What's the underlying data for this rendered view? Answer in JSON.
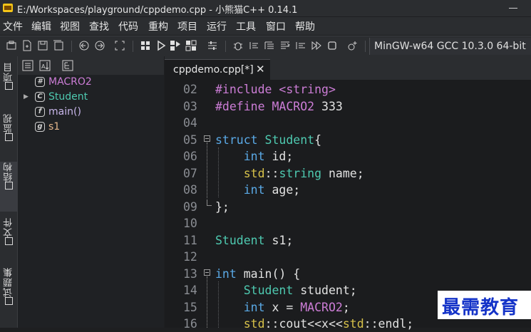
{
  "window": {
    "title": "E:/Workspaces/playground/cppdemo.cpp  - 小熊猫C++ 0.14.1"
  },
  "menu": [
    "文件",
    "编辑",
    "视图",
    "查找",
    "代码",
    "重构",
    "项目",
    "运行",
    "工具",
    "窗口",
    "帮助"
  ],
  "toolbar": {
    "compiler": "MinGW-w64 GCC 10.3.0 64-bit"
  },
  "left_tabs": [
    "项目",
    "监视",
    "结构",
    "文件",
    "试题集"
  ],
  "tree": [
    {
      "icon": "#",
      "label": "MACRO2",
      "color": "#cc7dd6",
      "expandable": false
    },
    {
      "icon": "C",
      "label": "Student",
      "color": "#4ec9b0",
      "expandable": true
    },
    {
      "icon": "f",
      "label": "main()",
      "color": "#c8b6ea",
      "expandable": false
    },
    {
      "icon": "g",
      "label": "s1",
      "color": "#e2b58a",
      "expandable": false
    }
  ],
  "editor": {
    "tab_label": "cppdemo.cpp[*]",
    "lines": [
      {
        "num": "02",
        "tokens": [
          [
            "pp",
            "#include"
          ],
          [
            "id",
            " "
          ],
          [
            "pp",
            "<string>"
          ]
        ]
      },
      {
        "num": "03",
        "tokens": [
          [
            "pp",
            "#define"
          ],
          [
            "id",
            " "
          ],
          [
            "macro",
            "MACRO2"
          ],
          [
            "id",
            " "
          ],
          [
            "num",
            "333"
          ]
        ]
      },
      {
        "num": "04",
        "tokens": []
      },
      {
        "num": "05",
        "tokens": [
          [
            "kw",
            "struct"
          ],
          [
            "id",
            " "
          ],
          [
            "ty",
            "Student"
          ],
          [
            "id",
            "{"
          ]
        ]
      },
      {
        "num": "06",
        "tokens": [
          [
            "id",
            "    "
          ],
          [
            "kw",
            "int"
          ],
          [
            "id",
            " id;"
          ]
        ]
      },
      {
        "num": "07",
        "tokens": [
          [
            "id",
            "    "
          ],
          [
            "ns",
            "std"
          ],
          [
            "id",
            "::"
          ],
          [
            "ty",
            "string"
          ],
          [
            "id",
            " name;"
          ]
        ]
      },
      {
        "num": "08",
        "tokens": [
          [
            "id",
            "    "
          ],
          [
            "kw",
            "int"
          ],
          [
            "id",
            " age;"
          ]
        ]
      },
      {
        "num": "09",
        "tokens": [
          [
            "id",
            "};"
          ]
        ]
      },
      {
        "num": "10",
        "tokens": []
      },
      {
        "num": "11",
        "tokens": [
          [
            "ty",
            "Student"
          ],
          [
            "id",
            " s1;"
          ]
        ]
      },
      {
        "num": "12",
        "tokens": []
      },
      {
        "num": "13",
        "tokens": [
          [
            "kw",
            "int"
          ],
          [
            "id",
            " main() {"
          ]
        ]
      },
      {
        "num": "14",
        "tokens": [
          [
            "id",
            "    "
          ],
          [
            "ty",
            "Student"
          ],
          [
            "id",
            " student;"
          ]
        ]
      },
      {
        "num": "15",
        "tokens": [
          [
            "id",
            "    "
          ],
          [
            "kw",
            "int"
          ],
          [
            "id",
            " x = "
          ],
          [
            "macro",
            "MACRO2"
          ],
          [
            "id",
            ";"
          ]
        ]
      },
      {
        "num": "16",
        "tokens": [
          [
            "id",
            "    "
          ],
          [
            "ns",
            "std"
          ],
          [
            "id",
            "::"
          ],
          [
            "id",
            "cout<<x<<"
          ],
          [
            "ns",
            "std"
          ],
          [
            "id",
            "::"
          ],
          [
            "id",
            "endl;"
          ]
        ]
      }
    ]
  },
  "watermark": "最需教育"
}
